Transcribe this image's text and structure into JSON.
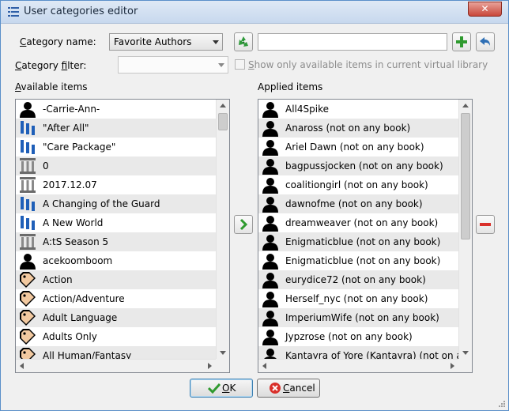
{
  "window": {
    "title": "User categories editor"
  },
  "category_name": {
    "label_prefix": "C",
    "label_rest": "ategory name:",
    "selected": "Favorite Authors",
    "text_value": ""
  },
  "category_filter": {
    "label_prefix": "C",
    "label_middle": "ategory ",
    "label_ul": "f",
    "label_rest": "ilter:",
    "selected": ""
  },
  "only_available": {
    "label_ul": "S",
    "label_rest": "how only available items in current virtual library",
    "checked": false
  },
  "available": {
    "header_ul": "A",
    "header_rest": "vailable items",
    "items": [
      {
        "label": "-Carrie-Ann-",
        "icon": "user-icon"
      },
      {
        "label": "\"After All\"",
        "icon": "series-icon"
      },
      {
        "label": "\"Care Package\"",
        "icon": "series-icon"
      },
      {
        "label": "0",
        "icon": "publisher-icon"
      },
      {
        "label": "2017.12.07",
        "icon": "publisher-icon"
      },
      {
        "label": "A Changing of the Guard",
        "icon": "series-icon"
      },
      {
        "label": "A New World",
        "icon": "series-icon"
      },
      {
        "label": "A:tS Season 5",
        "icon": "publisher-icon"
      },
      {
        "label": "acekoomboom",
        "icon": "user-icon"
      },
      {
        "label": "Action",
        "icon": "tag-icon"
      },
      {
        "label": "Action/Adventure",
        "icon": "tag-icon"
      },
      {
        "label": "Adult Language",
        "icon": "tag-icon"
      },
      {
        "label": "Adults Only",
        "icon": "tag-icon"
      },
      {
        "label": "All Human/Fantasy",
        "icon": "tag-icon"
      }
    ]
  },
  "applied": {
    "header_rest": "Applied items",
    "items": [
      {
        "label": "All4Spike",
        "icon": "user-icon"
      },
      {
        "label": "Anaross (not on any book)",
        "icon": "user-icon"
      },
      {
        "label": "Ariel Dawn (not on any book)",
        "icon": "user-icon"
      },
      {
        "label": "bagpussjocken (not on any book)",
        "icon": "user-icon"
      },
      {
        "label": "coalitiongirl (not on any book)",
        "icon": "user-icon"
      },
      {
        "label": "dawnofme (not on any book)",
        "icon": "user-icon"
      },
      {
        "label": "dreamweaver (not on any book)",
        "icon": "user-icon"
      },
      {
        "label": "Enigmaticblue (not on any book)",
        "icon": "user-icon"
      },
      {
        "label": "Enigmaticblue (not on any book)",
        "icon": "user-icon"
      },
      {
        "label": "eurydice72 (not on any book)",
        "icon": "user-icon"
      },
      {
        "label": "Herself_nyc (not on any book)",
        "icon": "user-icon"
      },
      {
        "label": "ImperiumWife (not on any book)",
        "icon": "user-icon"
      },
      {
        "label": "Jypzrose (not on any book)",
        "icon": "user-icon"
      },
      {
        "label": "Kantayra of Yore (Kantayra) (not on any book)",
        "icon": "user-icon"
      }
    ]
  },
  "buttons": {
    "ok_ul": "O",
    "ok_rest": "K",
    "cancel_ul": "C",
    "cancel_rest": "ancel"
  },
  "colors": {
    "accent_green": "#2f9a2f",
    "remove_red": "#d9302a",
    "undo_blue": "#2e6fb5"
  }
}
